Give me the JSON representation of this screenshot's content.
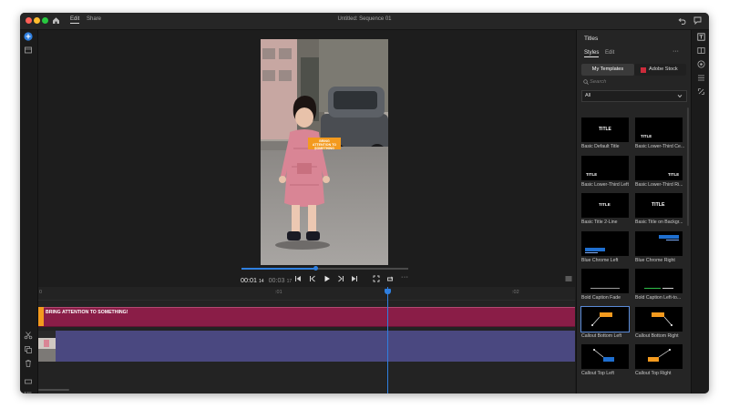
{
  "window": {
    "title": "Untitled: Sequence 01",
    "tabs": [
      {
        "label": "Edit",
        "active": true
      },
      {
        "label": "Share",
        "active": false
      }
    ]
  },
  "colors": {
    "title_track": "#8a1d47",
    "video_track": "#4a4880",
    "accent_blue": "#2f7fe0",
    "playhead": "#2f7fe0",
    "orange_callout": "#f39a1e"
  },
  "icons": {
    "left_toolbar": [
      "add-icon",
      "media-icon",
      "scissors-icon",
      "duplicate-icon",
      "trash-icon",
      "track-size-icon",
      "track-list-icon"
    ],
    "right_toolbar": [
      "titles-icon",
      "transitions-icon",
      "color-icon",
      "audio-icon",
      "transform-icon"
    ]
  },
  "preview": {
    "callout_text": "BRING ATTENTION TO SOMETHING"
  },
  "transport": {
    "current_time": "00:01",
    "current_frames": "14",
    "total_time": "00:03",
    "total_frames": "17",
    "progress": 0.44
  },
  "timeline": {
    "ruler_labels": [
      "0",
      ":01",
      ":02"
    ],
    "title_clip_text": "BRING ATTENTION TO SOMETHING!",
    "playhead_fraction": 0.65
  },
  "panel": {
    "title": "Titles",
    "tabs": [
      {
        "label": "Styles",
        "active": true
      },
      {
        "label": "Edit",
        "active": false
      }
    ],
    "more": "···",
    "source_my_templates": "My Templates",
    "source_adobe_stock": "Adobe Stock",
    "search_placeholder": "Search",
    "filter_value": "All",
    "templates": [
      {
        "name": "Basic Default Title",
        "preview": "TITLE",
        "selected": false
      },
      {
        "name": "Basic Lower-Third Ce...",
        "preview": "TITLE",
        "selected": false
      },
      {
        "name": "Basic Lower-Third Left",
        "preview": "TITLE",
        "selected": false
      },
      {
        "name": "Basic Lower-Third Ri...",
        "preview": "TITLE",
        "selected": false
      },
      {
        "name": "Basic Title 2-Line",
        "preview": "TITLE",
        "selected": false
      },
      {
        "name": "Basic Title on Backgr...",
        "preview": "TITLE",
        "selected": false
      },
      {
        "name": "Blue Chrome Left",
        "preview": "",
        "selected": false
      },
      {
        "name": "Blue Chrome Right",
        "preview": "",
        "selected": false
      },
      {
        "name": "Bold Caption Fade",
        "preview": "",
        "selected": false
      },
      {
        "name": "Bold Caption Left-to...",
        "preview": "",
        "selected": false
      },
      {
        "name": "Callout Bottom Left",
        "preview": "",
        "selected": true
      },
      {
        "name": "Callout Bottom Right",
        "preview": "",
        "selected": false
      },
      {
        "name": "Callout Top Left",
        "preview": "",
        "selected": false
      },
      {
        "name": "Callout Top Right",
        "preview": "",
        "selected": false
      }
    ]
  }
}
